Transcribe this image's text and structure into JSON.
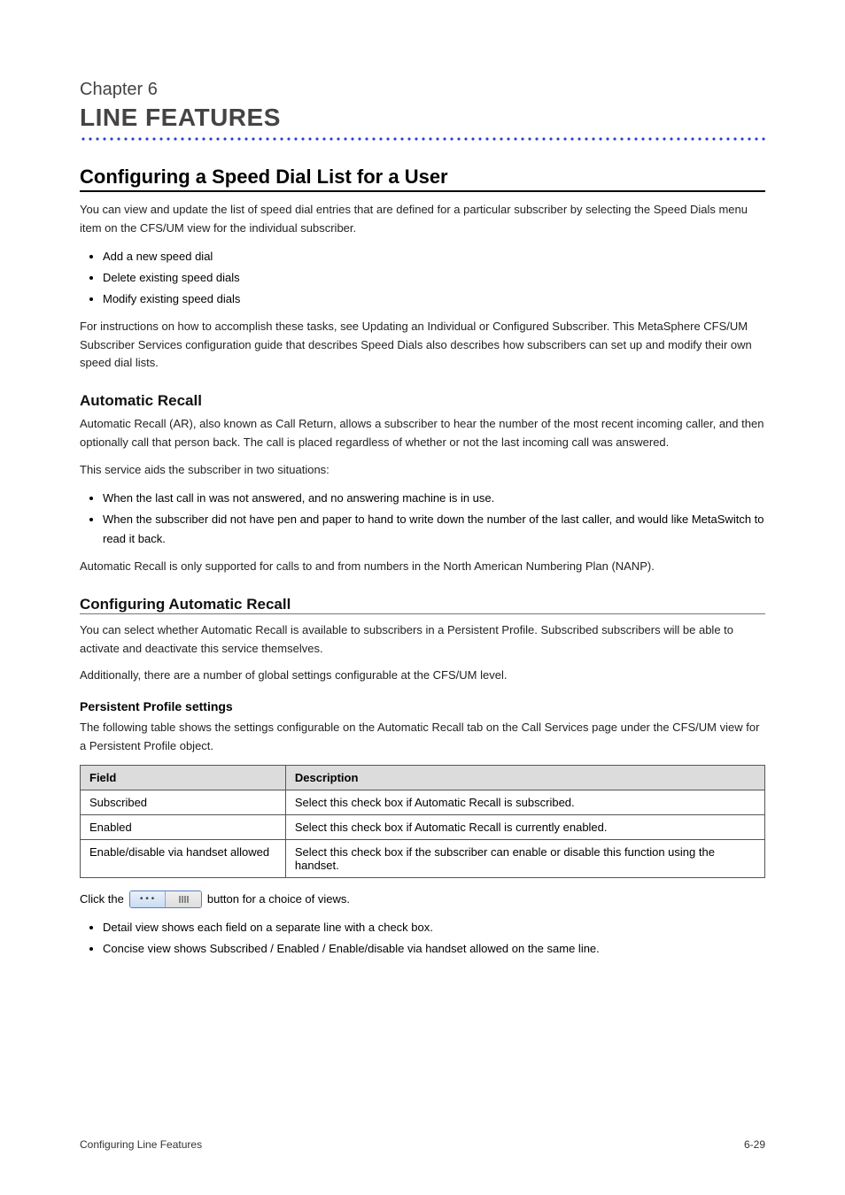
{
  "chapter": {
    "label": "Chapter 6",
    "title": "LINE FEATURES"
  },
  "section_title": "Configuring a Speed Dial List for a User",
  "intro_paragraph": "You can view and update the list of speed dial entries that are defined for a particular subscriber by selecting the Speed Dials menu item on the CFS/UM view for the individual subscriber.",
  "bullets": [
    "Add a new speed dial",
    "Delete existing speed dials",
    "Modify existing speed dials"
  ],
  "para_after_bullets": "For instructions on how to accomplish these tasks, see Updating an Individual or Configured Subscriber. This MetaSphere CFS/UM Subscriber Services configuration guide that describes Speed Dials also describes how subscribers can set up and modify their own speed dial lists.",
  "automatic_recall": {
    "heading": "Automatic Recall",
    "para1": "Automatic Recall (AR), also known as Call Return, allows a subscriber to hear the number of the most recent incoming caller, and then optionally call that person back. The call is placed regardless of whether or not the last incoming call was answered.",
    "para2": "This service aids the subscriber in two situations:",
    "ar_bullets": [
      "When the last call in was not answered, and no answering machine is in use.",
      "When the subscriber did not have pen and paper to hand to write down the number of the last caller, and would like MetaSwitch to read it back."
    ],
    "para3": "Automatic Recall is only supported for calls to and from numbers in the North American Numbering Plan (NANP)."
  },
  "configuring_ar": {
    "heading": "Configuring Automatic Recall",
    "para1": "You can select whether Automatic Recall is available to subscribers in a Persistent Profile. Subscribed subscribers will be able to activate and deactivate this service themselves.",
    "para2": "Additionally, there are a number of global settings configurable at the CFS/UM level.",
    "sub_profile_heading": "Persistent Profile settings",
    "sub_profile_intro": "The following table shows the settings configurable on the Automatic Recall tab on the Call Services page under the CFS/UM view for a Persistent Profile object."
  },
  "table": {
    "headers": [
      "Field",
      "Description"
    ],
    "rows": [
      [
        "Subscribed",
        "Select this check box if Automatic Recall is subscribed."
      ],
      [
        "Enabled",
        "Select this check box if Automatic Recall is currently enabled."
      ],
      [
        "Enable/disable via handset allowed",
        "Select this check box if the subscriber can enable or disable this function using the handset."
      ]
    ]
  },
  "view_choice": {
    "prefix": "Click the ",
    "btn_left": "•••",
    "btn_right_label": "bars",
    "rest": " button for a choice of views."
  },
  "final_bullets": [
    "Detail view shows each field on a separate line with a check box.",
    "Concise view shows Subscribed / Enabled / Enable/disable via handset allowed on the same line."
  ],
  "footer": {
    "left": "Configuring Line Features",
    "right": "6-29"
  }
}
